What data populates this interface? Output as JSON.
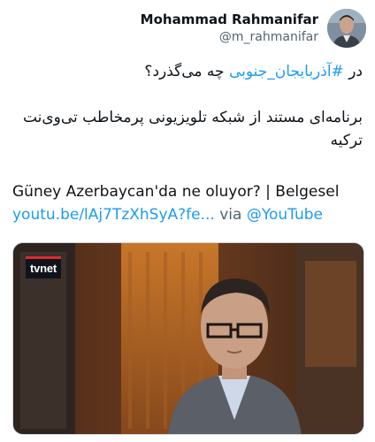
{
  "author": {
    "display_name": "Mohammad Rahmanifar",
    "handle": "@m_rahmanifar"
  },
  "tweet": {
    "line1_prefix": "در ",
    "line1_hashtag": "#آذربایجان_جنوبی",
    "line1_suffix": " چه می‌گذرد؟",
    "line2": "برنامه‌ای مستند از شبکه تلویزیونی پرمخاطب تی‌وی‌نت ترکیه",
    "line3": "Güney Azerbaycan'da ne oluyor? | Belgesel",
    "link_text": "youtu.be/lAj7TzXhSyA?fe...",
    "via_text": " via ",
    "via_mention": "@YouTube"
  },
  "media": {
    "logo_text": "tvnet"
  },
  "colors": {
    "accent": "#1d9bf0",
    "text": "#0f1419",
    "secondary": "#536471"
  }
}
